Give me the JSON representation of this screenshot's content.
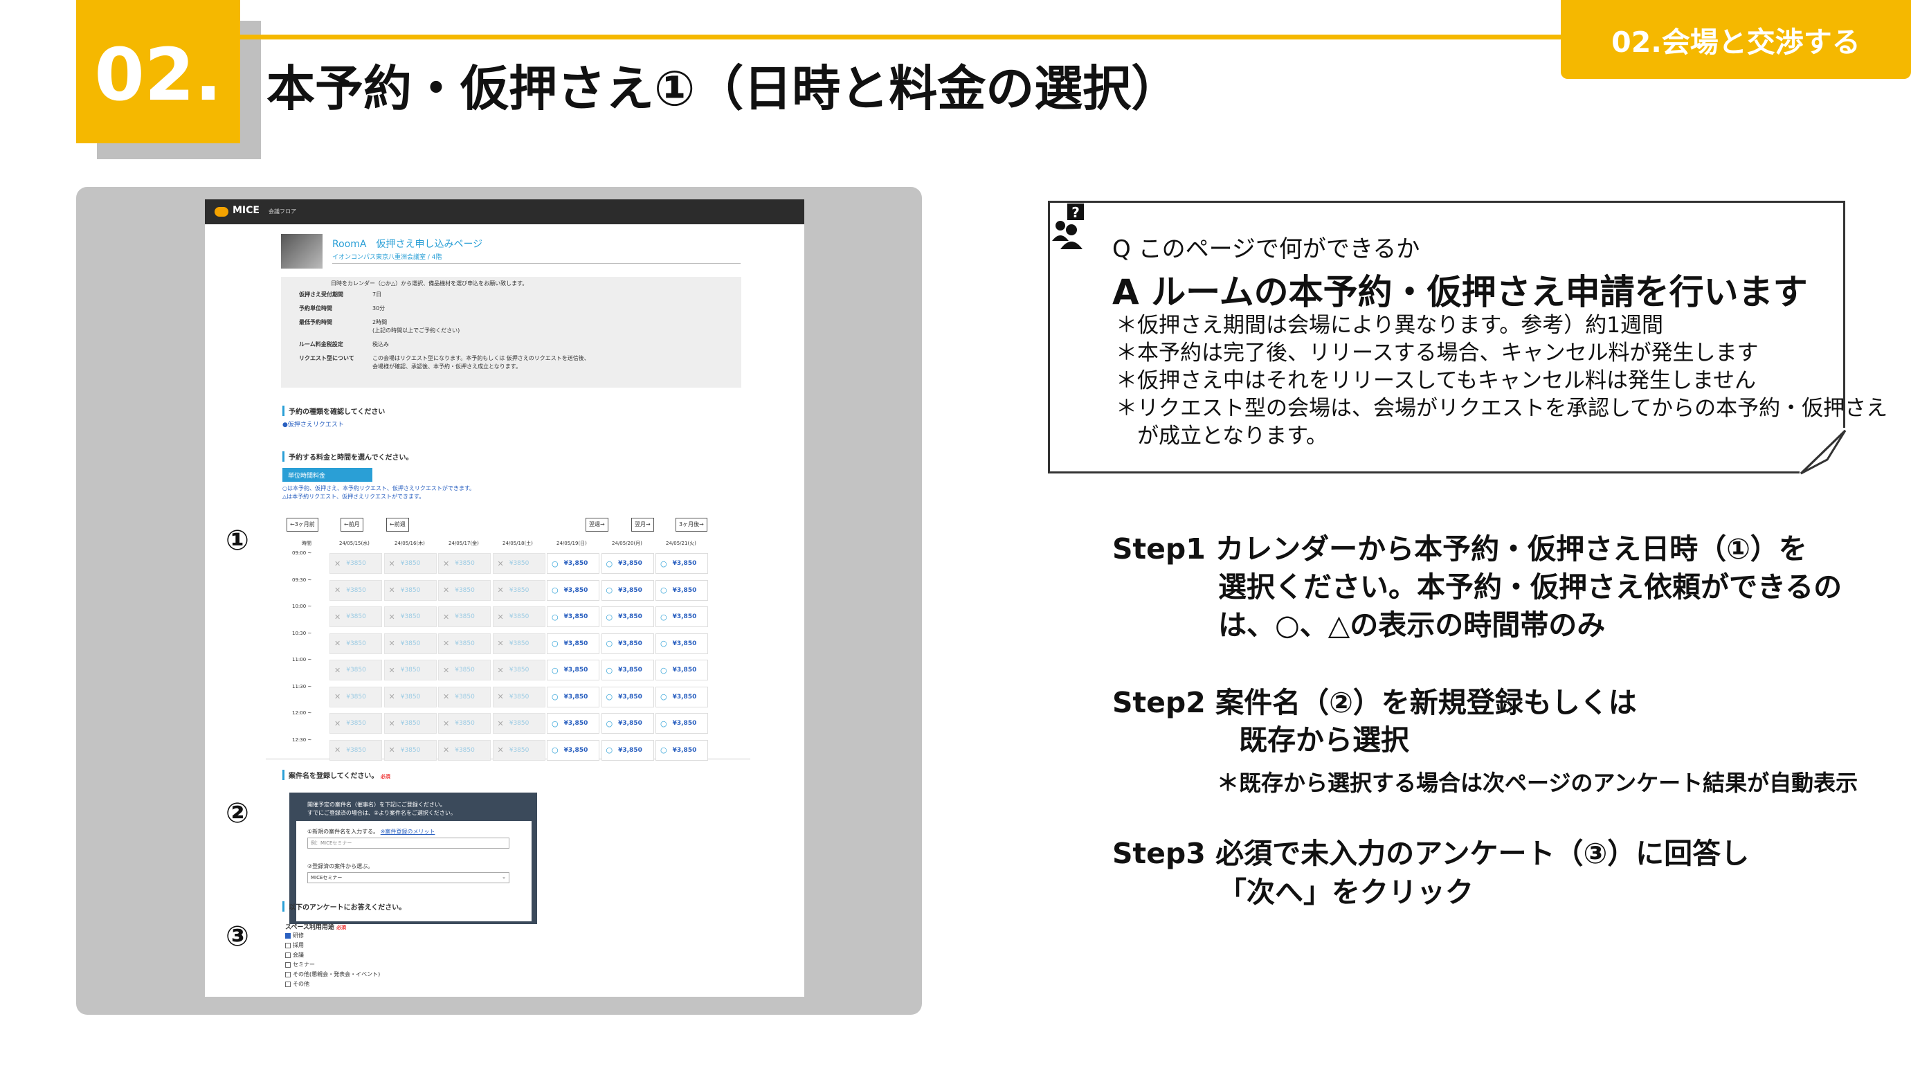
{
  "header": {
    "number": "02.",
    "title": "本予約・仮押さえ①（日時と料金の選択）",
    "section_tab": "02.会場と交渉する"
  },
  "screenshot": {
    "logo": "MICE",
    "logo_sub": "会議フロア",
    "room_title": "RoomA　仮押さえ申し込みページ",
    "room_sub": "イオンコンパス東京八重洲会議室 / 4階",
    "room_note": "日時をカレンダー（○か△）から選択、備品機材を選び申込をお願い致します。",
    "info": [
      {
        "label": "仮押さえ受付期間",
        "value": "7日"
      },
      {
        "label": "予約単位時間",
        "value": "30分"
      },
      {
        "label": "最低予約時間",
        "value": "2時間"
      },
      {
        "label": "",
        "value": "(上記の時間以上でご予約ください)"
      },
      {
        "label": "ルーム料金税設定",
        "value": "税込み"
      },
      {
        "label": "リクエスト型について",
        "value": "この会場はリクエスト型になります。本予約もしくは 仮押さえのリクエストを送信後、"
      },
      {
        "label": "",
        "value": "会場様が確認、承認後、本予約・仮押さえ成立となります。"
      }
    ],
    "type_heading": "予約の種類を確認してください",
    "type_value": "●仮押さえリクエスト",
    "rate_heading": "予約する料金と時間を選んでください。",
    "rate_tab": "単位時間料金",
    "legend1": "○は本予約、仮押さえ、本予約リクエスト、仮押さえリクエストができます。",
    "legend2": "△は本予約リクエスト、仮押さえリクエストができます。",
    "nav": [
      "←3ヶ月前",
      "←前月",
      "←前週",
      "翌週→",
      "翌月→",
      "3ヶ月後→"
    ],
    "time_header": "時間",
    "dates": [
      "24/05/15(水)",
      "24/05/16(木)",
      "24/05/17(金)",
      "24/05/18(土)",
      "24/05/19(日)",
      "24/05/20(月)",
      "24/05/21(火)"
    ],
    "times": [
      "09:00 ~",
      "09:30 ~",
      "10:00 ~",
      "10:30 ~",
      "11:00 ~",
      "11:30 ~",
      "12:00 ~",
      "12:30 ~"
    ],
    "price_x": "¥3850",
    "price_o": "¥3,850",
    "mark_x": "✕",
    "mark_o": "○",
    "case_heading": "案件名を登録してください。",
    "required": "必須",
    "case_desc1": "開催予定の案件名（催事名）を下記にご登録ください。",
    "case_desc2": "すでにご登録済の場合は、②より案件名をご選択ください。",
    "case_new_label": "①新規の案件名を入力する。",
    "case_new_link": "※案件登録のメリット",
    "case_new_placeholder": "例：MICEセミナー",
    "case_select_label": "②登録済の案件から選ぶ。",
    "case_select_value": "MICEセミナー",
    "survey_heading": "以下のアンケートにお答えください。",
    "survey_q": "スペース利用用途",
    "survey_options": [
      "研修",
      "採用",
      "会議",
      "セミナー",
      "その他(懇親会・発表会・イベント)",
      "その他"
    ],
    "markers": [
      "①",
      "②",
      "③"
    ]
  },
  "qa": {
    "q": "Q このページで何ができるか",
    "a": "A ルームの本予約・仮押さえ申請を行います",
    "notes": [
      "＊仮押さえ期間は会場により異なります。参考）約1週間",
      "＊本予約は完了後、リリースする場合、キャンセル料が発生します",
      "＊仮押さえ中はそれをリリースしてもキャンセル料は発生しません",
      "＊リクエスト型の会場は、会場がリクエストを承認してからの本予約・仮押さえ",
      "　が成立となります。"
    ]
  },
  "steps": {
    "s1a": "Step1 カレンダーから本予約・仮押さえ日時（①）を",
    "s1b": "選択ください。本予約・仮押さえ依頼ができるの",
    "s1c": "は、○、△の表示の時間帯のみ",
    "s2a": "Step2  案件名（②）を新規登録もしくは",
    "s2b": "既存から選択",
    "s2note": "＊既存から選択する場合は次ページのアンケート結果が自動表示",
    "s3a": "Step3 必須で未入力のアンケート（③）に回答し",
    "s3b": "「次へ」をクリック"
  },
  "colors": {
    "accent": "#f5b800",
    "link": "#2a9fd6"
  },
  "icons": [
    "person-question-icon"
  ]
}
